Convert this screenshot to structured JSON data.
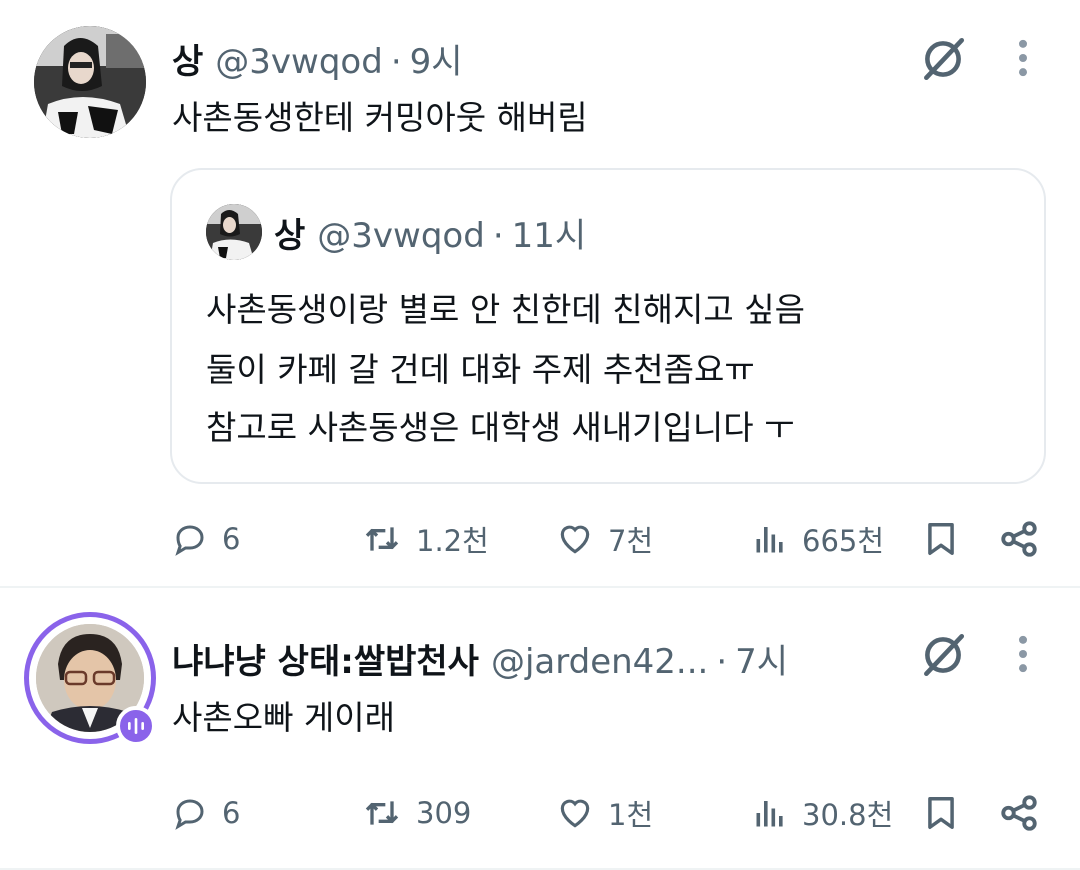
{
  "tweets": [
    {
      "name": "상",
      "handle": "@3vwqod",
      "sep": "·",
      "time": "9시",
      "text": "사촌동생한테 커밍아웃 해버림",
      "quote": {
        "name": "상",
        "handle": "@3vwqod",
        "sep": "·",
        "time": "11시",
        "lines": [
          "사촌동생이랑 별로 안 친한데 친해지고 싶음",
          "둘이 카페 갈 건데 대화 주제 추천좀요ㅠ",
          "참고로 사촌동생은 대학생 새내기입니다 ㅜ"
        ]
      },
      "replies": "6",
      "retweets": "1.2천",
      "likes": "7천",
      "views": "665천"
    },
    {
      "name": "냐냐냥 상태:쌀밥천사",
      "handle": "@jarden42...",
      "sep": "·",
      "time": "7시",
      "text": "사촌오빠 게이래",
      "replies": "6",
      "retweets": "309",
      "likes": "1천",
      "views": "30.8천"
    }
  ],
  "colors": {
    "text": "#0f1419",
    "secondary": "#536471",
    "border": "#e6eaee",
    "avatar_ring": "#8a63ea"
  },
  "icons": [
    "grok-icon",
    "more-icon",
    "reply-icon",
    "retweet-icon",
    "like-icon",
    "views-icon",
    "bookmark-icon",
    "share-icon",
    "voice-badge-icon"
  ]
}
